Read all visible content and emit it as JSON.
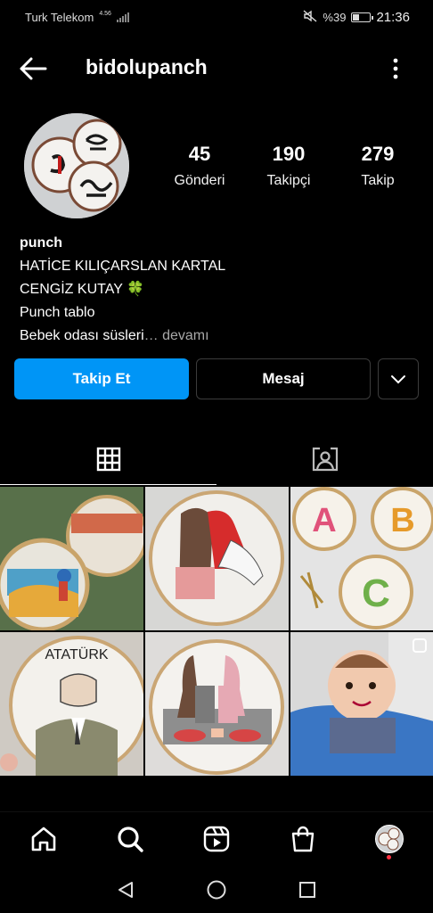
{
  "status_bar": {
    "carrier": "Turk Telekom",
    "net_speed": "4.56",
    "battery": "%39",
    "battery_level": 0.39,
    "time": "21:36"
  },
  "header": {
    "username": "bidolupanch",
    "back_icon": "arrow-left-icon",
    "more_icon": "vertical-dots-icon"
  },
  "profile": {
    "stats": [
      {
        "count": "45",
        "label": "Gönderi"
      },
      {
        "count": "190",
        "label": "Takipçi"
      },
      {
        "count": "279",
        "label": "Takip"
      }
    ],
    "bio": {
      "name": "punch",
      "line1": "HATİCE KILIÇARSLAN KARTAL",
      "line2": "CENGİZ KUTAY 🍀",
      "line3": "Punch tablo",
      "line4": "Bebek odası süsleri",
      "more": "… devamı"
    }
  },
  "actions": {
    "follow": "Takip Et",
    "message": "Mesaj",
    "suggest_icon": "chevron-down-icon"
  },
  "tabs": [
    {
      "name": "grid",
      "icon": "grid-icon",
      "active": true
    },
    {
      "name": "tagged",
      "icon": "tagged-person-icon",
      "active": false
    }
  ],
  "grid": {
    "posts": [
      {
        "label": ""
      },
      {
        "label": ""
      },
      {
        "label": ""
      },
      {
        "label": "ATATÜRK"
      },
      {
        "label": ""
      },
      {
        "label": ""
      }
    ]
  },
  "bottom_nav": [
    {
      "icon": "home-icon"
    },
    {
      "icon": "search-icon"
    },
    {
      "icon": "reels-icon"
    },
    {
      "icon": "shop-icon"
    },
    {
      "icon": "profile-avatar"
    }
  ],
  "system_nav": [
    {
      "icon": "back-triangle-icon"
    },
    {
      "icon": "home-circle-icon"
    },
    {
      "icon": "recents-square-icon"
    }
  ],
  "colors": {
    "background": "#000000",
    "accent": "#0095f6",
    "notification_dot": "#ff3040",
    "muted_text": "#a8a8a8"
  }
}
